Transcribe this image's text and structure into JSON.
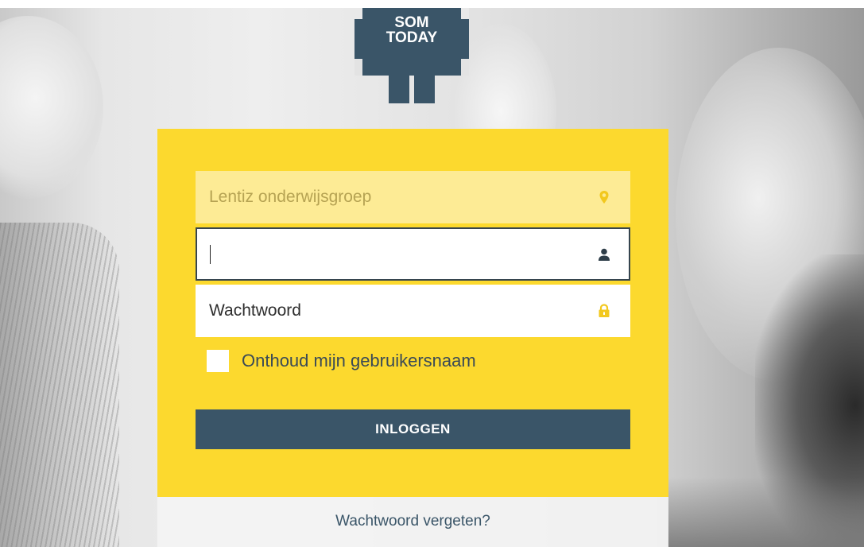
{
  "logo": {
    "line1": "SOM",
    "line2": "TODAY"
  },
  "login": {
    "school_value": "Lentiz onderwijsgroep",
    "school_icon": "map-marker-icon",
    "username_value": "",
    "username_icon": "user-icon",
    "password_placeholder": "Wachtwoord",
    "password_icon": "lock-icon",
    "remember_label": "Onthoud mijn gebruikersnaam",
    "remember_checked": false,
    "submit_label": "INLOGGEN",
    "forgot_label": "Wachtwoord vergeten?"
  },
  "colors": {
    "card": "#fcd92e",
    "primary": "#3a5568",
    "school_field": "#fdeb95",
    "icon_yellow": "#f2c81e"
  }
}
